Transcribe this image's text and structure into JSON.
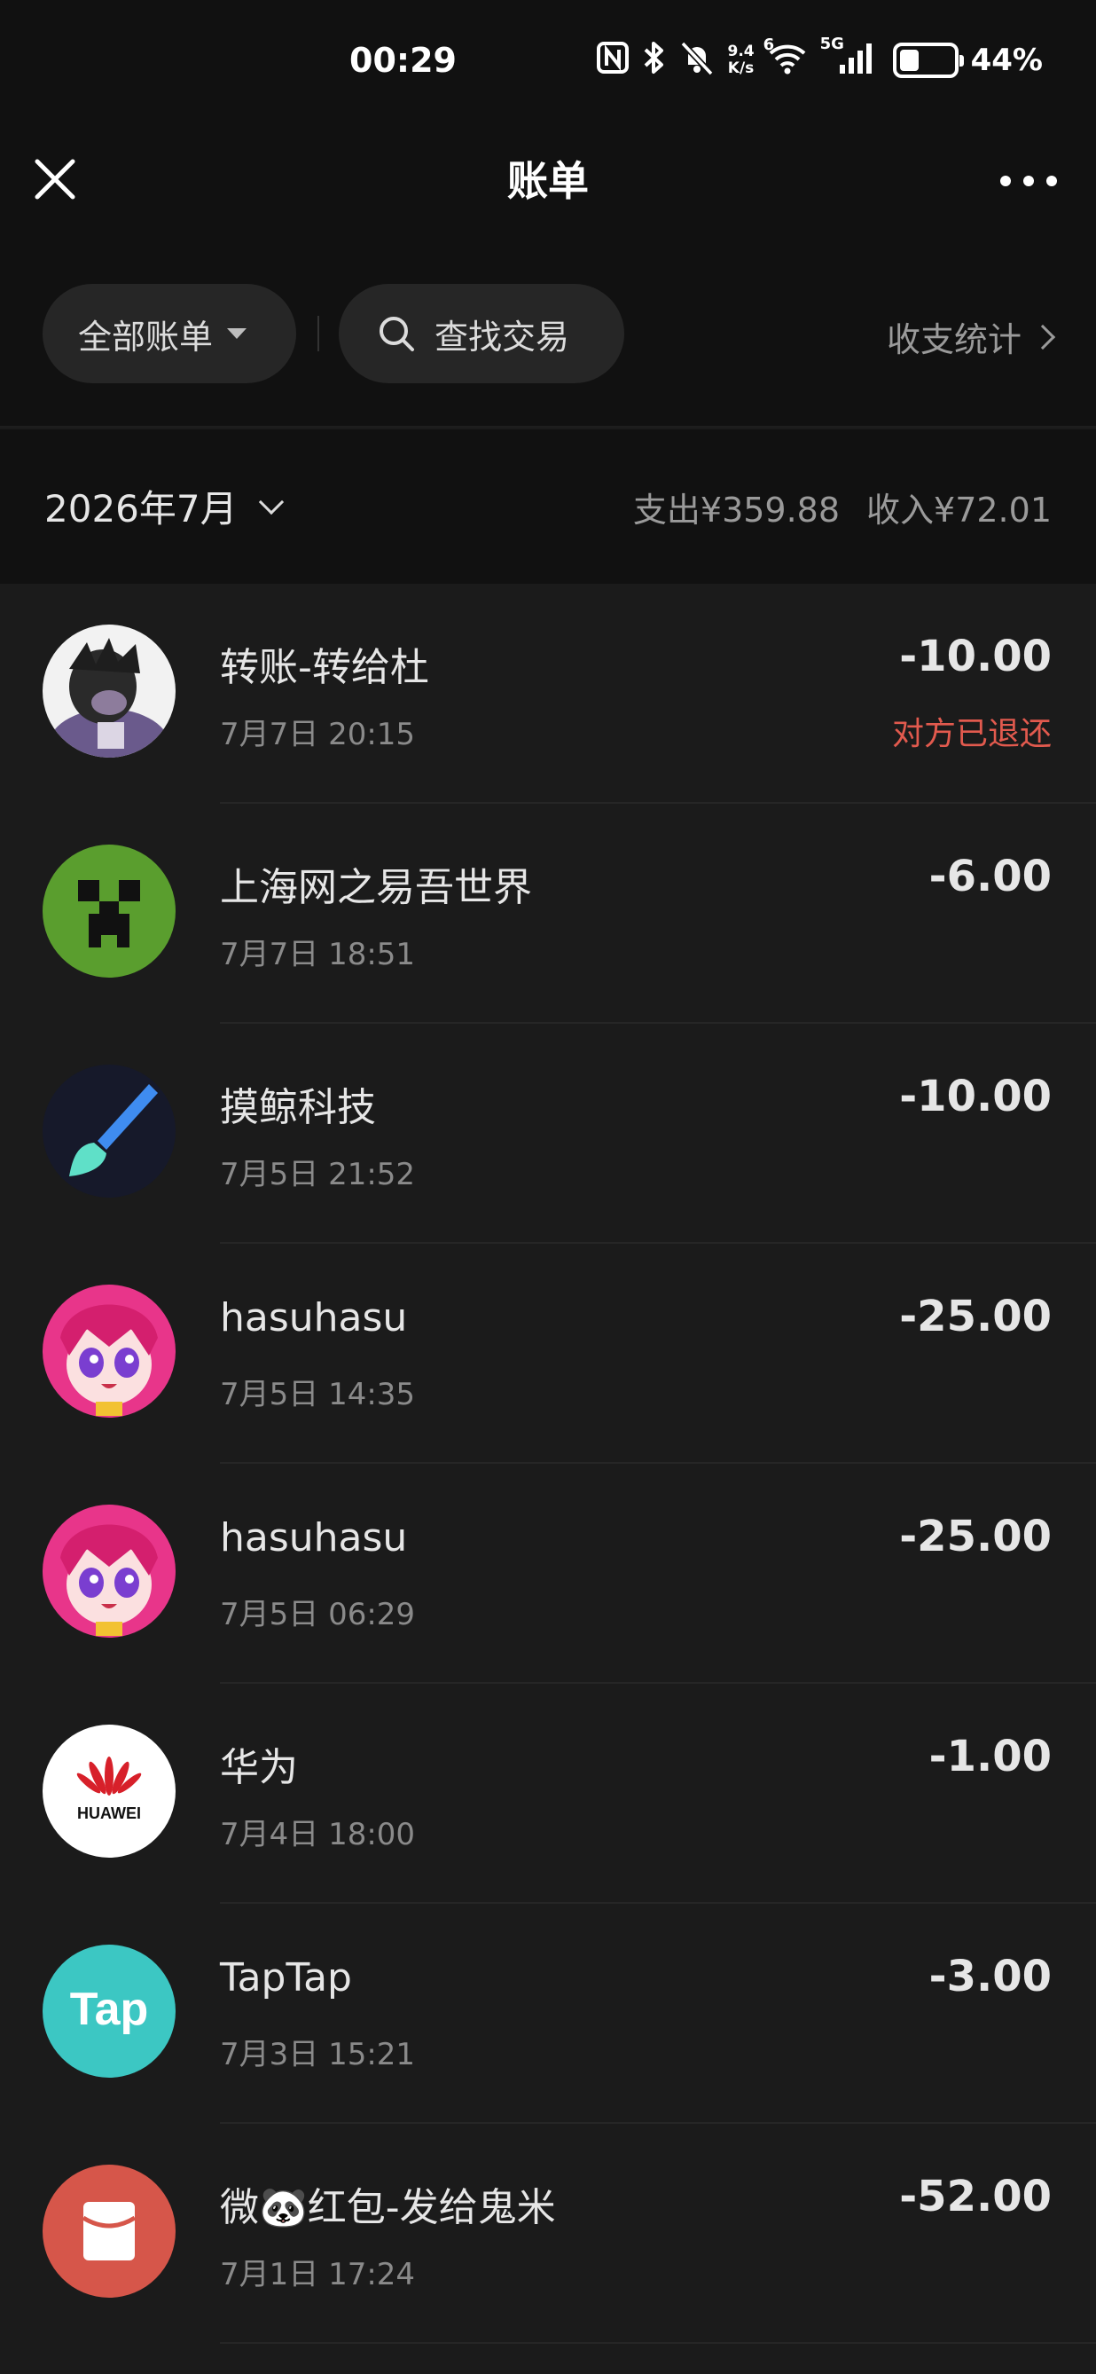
{
  "status_bar": {
    "time": "00:29",
    "net_speed_value": "9.4",
    "net_speed_unit": "K/s",
    "wifi_badge": "6",
    "cell_badge": "5G",
    "battery_percent": "44%",
    "battery_level": 0.44,
    "icons": [
      "nfc-icon",
      "bluetooth-icon",
      "mute-icon",
      "wifi-icon",
      "signal-icon",
      "battery-icon"
    ]
  },
  "header": {
    "title": "账单"
  },
  "filters": {
    "all_bills": "全部账单",
    "search": "查找交易",
    "stats": "收支统计"
  },
  "month": {
    "label": "2026年7月",
    "expense": "支出¥359.88",
    "income": "收入¥72.01"
  },
  "transactions": [
    {
      "title": "转账-转给杜",
      "date": "7月7日  20:15",
      "amount": "-10.00",
      "note": "对方已退还",
      "avatar": "dark-character-avatar"
    },
    {
      "title": "上海网之易吾世界",
      "date": "7月7日  18:51",
      "amount": "-6.00",
      "note": "",
      "avatar": "creeper-avatar"
    },
    {
      "title": "摸鲸科技",
      "date": "7月5日  21:52",
      "amount": "-10.00",
      "note": "",
      "avatar": "paintbrush-avatar"
    },
    {
      "title": "hasuhasu",
      "date": "7月5日  14:35",
      "amount": "-25.00",
      "note": "",
      "avatar": "anime-girl-avatar"
    },
    {
      "title": "hasuhasu",
      "date": "7月5日  06:29",
      "amount": "-25.00",
      "note": "",
      "avatar": "anime-girl-avatar"
    },
    {
      "title": "华为",
      "date": "7月4日  18:00",
      "amount": "-1.00",
      "note": "",
      "avatar": "huawei-avatar",
      "avatar_text": "HUAWEI"
    },
    {
      "title": "TapTap",
      "date": "7月3日  15:21",
      "amount": "-3.00",
      "note": "",
      "avatar": "taptap-avatar",
      "avatar_text": "Tap"
    },
    {
      "title": "微🐼红包-发给鬼米",
      "date": "7月1日  17:24",
      "amount": "-52.00",
      "note": "",
      "avatar": "red-packet-avatar"
    }
  ],
  "colors": {
    "background": "#1b1b1b",
    "header_bg": "#111111",
    "refund_note": "#e25a4e",
    "creeper_green": "#5a9e2e",
    "taptap_teal": "#3cc7c3",
    "red_packet": "#d6564a"
  }
}
